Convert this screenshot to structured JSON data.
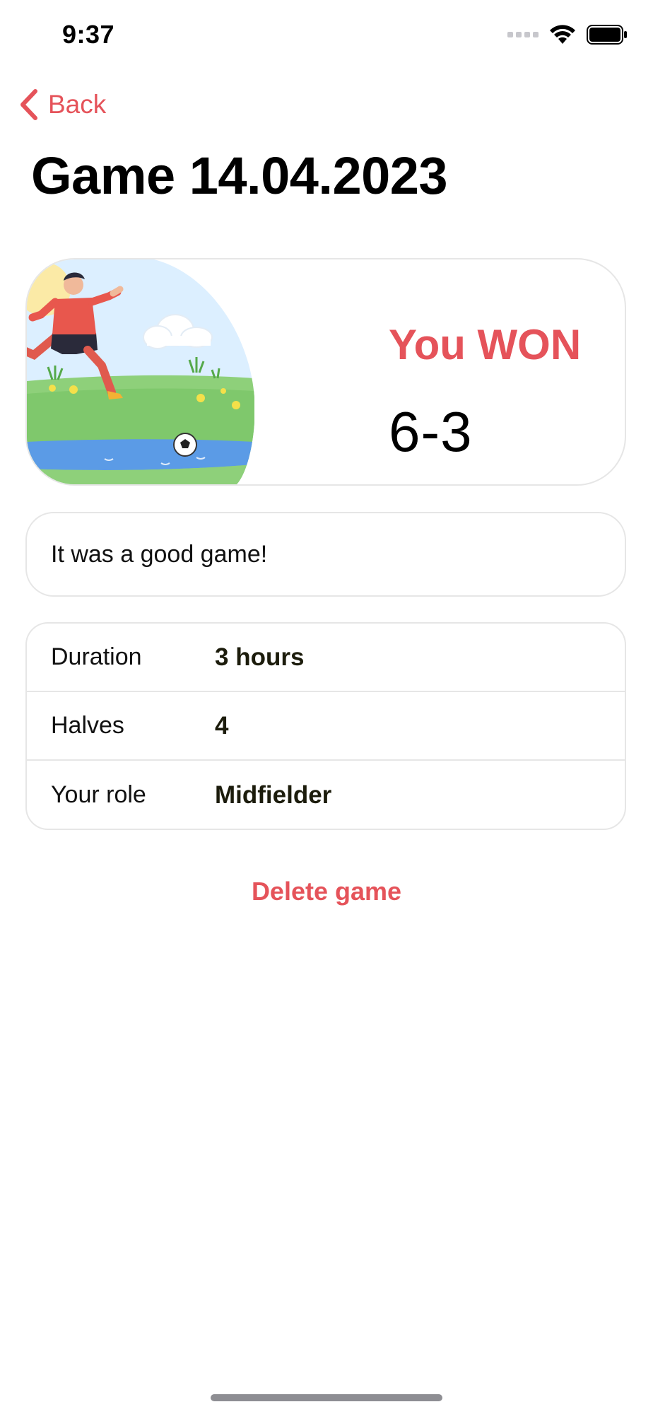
{
  "status_bar": {
    "time": "9:37",
    "icons": [
      "signal-icon",
      "wifi-icon",
      "battery-icon"
    ]
  },
  "nav": {
    "back_label": "Back",
    "back_icon": "chevron-left-icon"
  },
  "page": {
    "title": "Game 14.04.2023"
  },
  "result": {
    "illustration": "soccer-player-illustration",
    "outcome_text": "You WON",
    "score": "6-3"
  },
  "note": {
    "text": "It was a good game!"
  },
  "details": [
    {
      "label": "Duration",
      "value": "3 hours"
    },
    {
      "label": "Halves",
      "value": "4"
    },
    {
      "label": "Your role",
      "value": "Midfielder"
    }
  ],
  "actions": {
    "delete_label": "Delete game"
  },
  "colors": {
    "accent": "#e5535a",
    "border": "#e6e6e6",
    "text": "#111111"
  }
}
